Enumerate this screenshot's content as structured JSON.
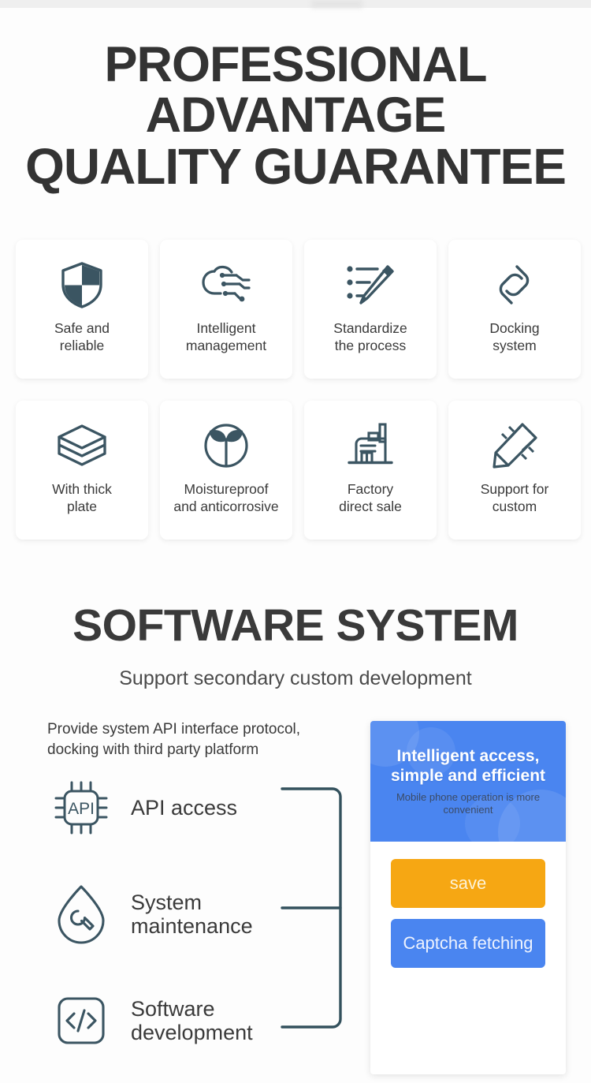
{
  "hero": {
    "line1": "PROFESSIONAL",
    "line2": "ADVANTAGE",
    "line3": "QUALITY GUARANTEE"
  },
  "features": [
    {
      "icon": "shield-icon",
      "label": "Safe and\nreliable"
    },
    {
      "icon": "cloud-circuit-icon",
      "label": "Intelligent\nmanagement"
    },
    {
      "icon": "checklist-pencil-icon",
      "label": "Standardize\nthe process"
    },
    {
      "icon": "link-chain-icon",
      "label": "Docking\nsystem"
    },
    {
      "icon": "layers-icon",
      "label": "With thick\nplate"
    },
    {
      "icon": "sprout-circle-icon",
      "label": "Moistureproof\nand anticorrosive"
    },
    {
      "icon": "factory-icon",
      "label": "Factory\ndirect sale"
    },
    {
      "icon": "pen-ruler-icon",
      "label": "Support for\ncustom"
    }
  ],
  "software": {
    "title": "SOFTWARE SYSTEM",
    "subtitle": "Support secondary custom development",
    "description": "Provide system API interface protocol,\ndocking with third party platform",
    "items": [
      {
        "icon": "api-chip-icon",
        "label": "API access"
      },
      {
        "icon": "droplet-wrench-icon",
        "label": "System\nmaintenance"
      },
      {
        "icon": "code-brackets-icon",
        "label": "Software\ndevelopment"
      }
    ]
  },
  "phone": {
    "banner_title": "Intelligent access,\nsimple and efficient",
    "banner_subtitle": "Mobile phone operation is more\nconvenient",
    "save_label": "save",
    "captcha_label": "Captcha fetching"
  },
  "colors": {
    "icon": "#3b5562",
    "heading": "#333333",
    "card_bg": "#ffffff",
    "page_bg": "#fdfdfd",
    "banner_blue": "#4a85f0",
    "save_orange": "#f6a713",
    "captcha_blue": "#4a85f0"
  }
}
